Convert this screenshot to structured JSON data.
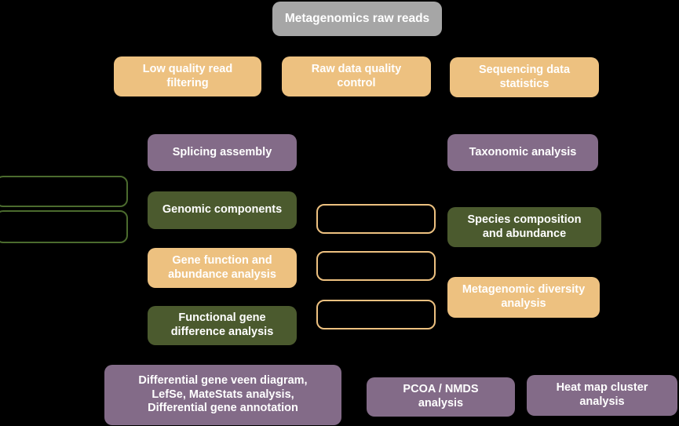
{
  "diagram": {
    "title": "Metagenomics raw reads",
    "background_color": "#000000",
    "palette": {
      "gray": "#a6a6a6",
      "orange": "#edc180",
      "purple": "#836b88",
      "green": "#4b5a2e",
      "text": "#ffffff"
    },
    "nodes": [
      {
        "id": "raw-reads",
        "label": "Metagenomics raw reads"
      },
      {
        "id": "low-quality-filter",
        "label": "Low quality read\nfiltering"
      },
      {
        "id": "raw-data-qc",
        "label": "Raw data quality\ncontrol"
      },
      {
        "id": "sequencing-stats",
        "label": "Sequencing data\nstatistics"
      },
      {
        "id": "splicing-assembly",
        "label": "Splicing assembly"
      },
      {
        "id": "taxonomic-analysis",
        "label": "Taxonomic analysis"
      },
      {
        "id": "genomic-components",
        "label": "Genomic components"
      },
      {
        "id": "species-composition",
        "label": "Species composition\nand abundance"
      },
      {
        "id": "gene-function",
        "label": "Gene function and\nabundance analysis"
      },
      {
        "id": "metagenomic-diversity",
        "label": "Metagenomic diversity\nanalysis"
      },
      {
        "id": "functional-gene-diff",
        "label": "Functional gene\ndifference analysis"
      },
      {
        "id": "differential-gene",
        "label": "Differential gene veen diagram,\nLefSe, MateStats analysis,\nDifferential gene annotation"
      },
      {
        "id": "pcoa-nmds",
        "label": "PCOA / NMDS\nanalysis"
      },
      {
        "id": "heat-map-cluster",
        "label": "Heat map cluster\nanalysis"
      },
      {
        "id": "outline-left-1",
        "label": ""
      },
      {
        "id": "outline-left-2",
        "label": ""
      },
      {
        "id": "outline-center-1",
        "label": ""
      },
      {
        "id": "outline-center-2",
        "label": ""
      },
      {
        "id": "outline-center-3",
        "label": ""
      }
    ]
  }
}
